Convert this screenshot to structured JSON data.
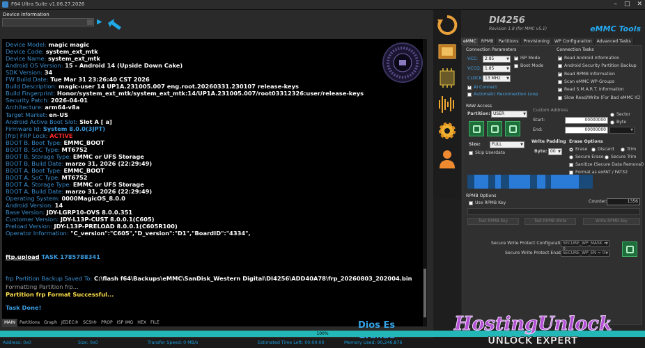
{
  "window": {
    "title": "F64 Ultra Suite v1.06.27.2026"
  },
  "left": {
    "device_info_label": "Device Information",
    "console_lines": [
      [
        {
          "t": "Device Model: ",
          "c": "lbl"
        },
        {
          "t": "magic magic",
          "c": "val"
        }
      ],
      [
        {
          "t": "Device Code: ",
          "c": "lbl"
        },
        {
          "t": "system_ext_mtk",
          "c": "val"
        }
      ],
      [
        {
          "t": "Device Name: ",
          "c": "lbl"
        },
        {
          "t": "system_ext_mtk",
          "c": "val"
        }
      ],
      [
        {
          "t": "Android OS Version: ",
          "c": "lbl"
        },
        {
          "t": "15 - Android 14 (Upside Down Cake)",
          "c": "val"
        }
      ],
      [
        {
          "t": "SDK Version: ",
          "c": "lbl"
        },
        {
          "t": "34",
          "c": "val"
        }
      ],
      [
        {
          "t": "FW Build Date: ",
          "c": "lbl"
        },
        {
          "t": "Tue Mar 31 23:26:40 CST 2026",
          "c": "val"
        }
      ],
      [
        {
          "t": "Build Description: ",
          "c": "lbl"
        },
        {
          "t": "magic-user 14 UP1A.231005.007 eng.root.20260331.230107 release-keys",
          "c": "val"
        }
      ],
      [
        {
          "t": "Build Fingerprint: ",
          "c": "lbl"
        },
        {
          "t": "Honor/system_ext_mtk/system_ext_mtk:14/UP1A.231005.007/root03312326:user/release-keys",
          "c": "val"
        }
      ],
      [
        {
          "t": "Security Patch: ",
          "c": "lbl"
        },
        {
          "t": "2026-04-01",
          "c": "val"
        }
      ],
      [
        {
          "t": "Architecture: ",
          "c": "lbl"
        },
        {
          "t": "arm64-v8a",
          "c": "val"
        }
      ],
      [
        {
          "t": "Target Market: ",
          "c": "lbl"
        },
        {
          "t": "en-US",
          "c": "val"
        }
      ],
      [
        {
          "t": "Android Active Boot Slot: ",
          "c": "lbl"
        },
        {
          "t": "Slot A [ a]",
          "c": "val"
        }
      ],
      [
        {
          "t": "Firmware Id: ",
          "c": "lbl"
        },
        {
          "t": "System 8.0.0(3JPT)",
          "c": "blueb"
        }
      ],
      [
        {
          "t": "[frp] FRP Lock: ",
          "c": "lbl"
        },
        {
          "t": "ACTIVE",
          "c": "red"
        }
      ],
      [
        {
          "t": "BOOT B, Boot Type: ",
          "c": "lbl"
        },
        {
          "t": "EMMC_BOOT",
          "c": "val"
        }
      ],
      [
        {
          "t": "BOOT B, SoC Type: ",
          "c": "lbl"
        },
        {
          "t": "MT6752",
          "c": "val"
        }
      ],
      [
        {
          "t": "BOOT B, Storage Type: ",
          "c": "lbl"
        },
        {
          "t": "EMMC or UFS Storage",
          "c": "val"
        }
      ],
      [
        {
          "t": "BOOT B, Build Date: ",
          "c": "lbl"
        },
        {
          "t": "marzo 31, 2026 (22:29:49)",
          "c": "val"
        }
      ],
      [
        {
          "t": "BOOT A, Boot Type: ",
          "c": "lbl"
        },
        {
          "t": "EMMC_BOOT",
          "c": "val"
        }
      ],
      [
        {
          "t": "BOOT A, SoC Type: ",
          "c": "lbl"
        },
        {
          "t": "MT6752",
          "c": "val"
        }
      ],
      [
        {
          "t": "BOOT A, Storage Type: ",
          "c": "lbl"
        },
        {
          "t": "EMMC or UFS Storage",
          "c": "val"
        }
      ],
      [
        {
          "t": "BOOT A, Build Date: ",
          "c": "lbl"
        },
        {
          "t": "marzo 31, 2026 (22:29:49)",
          "c": "val"
        }
      ],
      [
        {
          "t": "Operating System: ",
          "c": "lbl"
        },
        {
          "t": "0000MagicOS_8.0.0",
          "c": "val"
        }
      ],
      [
        {
          "t": "Android Version: ",
          "c": "lbl"
        },
        {
          "t": "14",
          "c": "val"
        }
      ],
      [
        {
          "t": "Base Version: ",
          "c": "lbl"
        },
        {
          "t": "JDY-LGRP10-OVS 8.0.0.351",
          "c": "val"
        }
      ],
      [
        {
          "t": "Customer Version: ",
          "c": "lbl"
        },
        {
          "t": "JDY-L13P-CUST 8.0.0.1(C605)",
          "c": "val"
        }
      ],
      [
        {
          "t": "Preload Version: ",
          "c": "lbl"
        },
        {
          "t": "JDY-L13P-PRELOAD 8.0.0.1(C605R100)",
          "c": "val"
        }
      ],
      [
        {
          "t": "Operator Information: ",
          "c": "lbl"
        },
        {
          "t": "\"C_version\":\"C605\",\"D_version\":\"D1\",\"BoardID\":\"4334\",",
          "c": "val"
        }
      ]
    ],
    "ftp_line": {
      "a": "ftp.upload",
      "b": " TASK 1785788341"
    },
    "backup_line": {
      "a": "frp Partition Backup Saved To: ",
      "b": "C:\\flash f64\\Backups\\eMMC\\SanDisk_Western Digital\\DI4256\\ADD40A78\\frp_20260803_202004.bin"
    },
    "formatting_line": "Formatting Partition frp...",
    "success_line": "Partition frp Format Successful...",
    "done_line": "Task Done!",
    "bottom_tabs": [
      "MAIN",
      "Partitions",
      "Graph",
      "JEDEC®",
      "SCSI®",
      "PROP",
      "ISP IMG",
      "HEX",
      "FILE"
    ],
    "slogan": "Dios  Es Grande"
  },
  "progress": {
    "percent_label": "100%",
    "value": 1.0
  },
  "status": {
    "address": "Address: 0x0",
    "size": "Size: 0x0",
    "speed": "Transfer Speed: 0 MB/s",
    "time_left": "Estimated Time Left: 00:00:00",
    "memory": "Memory Used: 90,246,876"
  },
  "right": {
    "device_name": "DI4256",
    "revision": "Revision 1.8 (for MMC v5.1)",
    "brand": "eMMC Tools",
    "tabs": [
      "eMMC",
      "RPMB",
      "Partitions",
      "Provisioning",
      "WP Configuration",
      "Advanced Tasks"
    ],
    "conn_params": {
      "title": "Connection Parameters",
      "vcc_label": "VCC:",
      "vcc": "2.85",
      "vccq_label": "VCCQ:",
      "vccq": "1.85",
      "clock_label": "CLOCK:",
      "clock": "13 MHz",
      "isp_mode": "ISP Mode",
      "boot_mode": "Boot Mode",
      "ai_connect": "AI Connect",
      "auto_reconnect": "Automatic Reconnection Loop"
    },
    "conn_tasks": {
      "title": "Connection Tasks",
      "items": [
        {
          "label": "Read Android Information",
          "on": true
        },
        {
          "label": "Android Security Partition Backup",
          "on": false
        },
        {
          "label": "Read RPMB Information",
          "on": true
        },
        {
          "label": "Scan eMMC WP-Groups",
          "on": false
        },
        {
          "label": "Read S.M.A.R.T. Information",
          "on": true
        },
        {
          "label": "Slow Read/Write (For Bad eMMC IC)",
          "on": false
        }
      ]
    },
    "raw_access": {
      "title": "RAW Access",
      "partition_label": "Partition:",
      "partition": "USER",
      "custom_address": "Custom Address",
      "start_label": "Start:",
      "start": "00000000",
      "end_label": "End:",
      "end": "00000000",
      "sector": "Sector",
      "byte": "Byte",
      "size_label": "Size:",
      "size": "FULL",
      "skip_userdata": "Skip Userdata",
      "write_padding": "Write Padding",
      "byte_label": "Byte:",
      "byte_val": "00",
      "erase_options": "Erase Options",
      "erase": "Erase",
      "discard": "Discard",
      "trim": "Trim",
      "secure_erase": "Secure Erase",
      "secure_trim": "Secure Trim",
      "sanitize": "Sanitize (Secure Data Removal)",
      "format_exfat": "Format as exFAT / FAT32"
    },
    "rpmb": {
      "title": "RPMB Options",
      "use_key": "Use RPMB Key",
      "counter_label": "Counter:",
      "counter": "1356",
      "test_key": "Test RPMB Key",
      "test_write": "Test RPMB Write",
      "write_key": "Write RPMB Key"
    },
    "swp": {
      "config_label": "Secure Write Protect Configuration:",
      "config": "SECURE_WP_MASK = 0",
      "enable_label": "Secure Write Protect Enable:",
      "enable": "SECURE_WP_EN = 0"
    }
  },
  "watermark": {
    "line1": "HostingUnlock",
    "line2": "UNLOCK EXPERT"
  },
  "colors": {
    "accent": "#25aaf0",
    "console_label": "#3a8fd0",
    "alert": "#ff2a2a",
    "progress": "#23b7b7"
  }
}
